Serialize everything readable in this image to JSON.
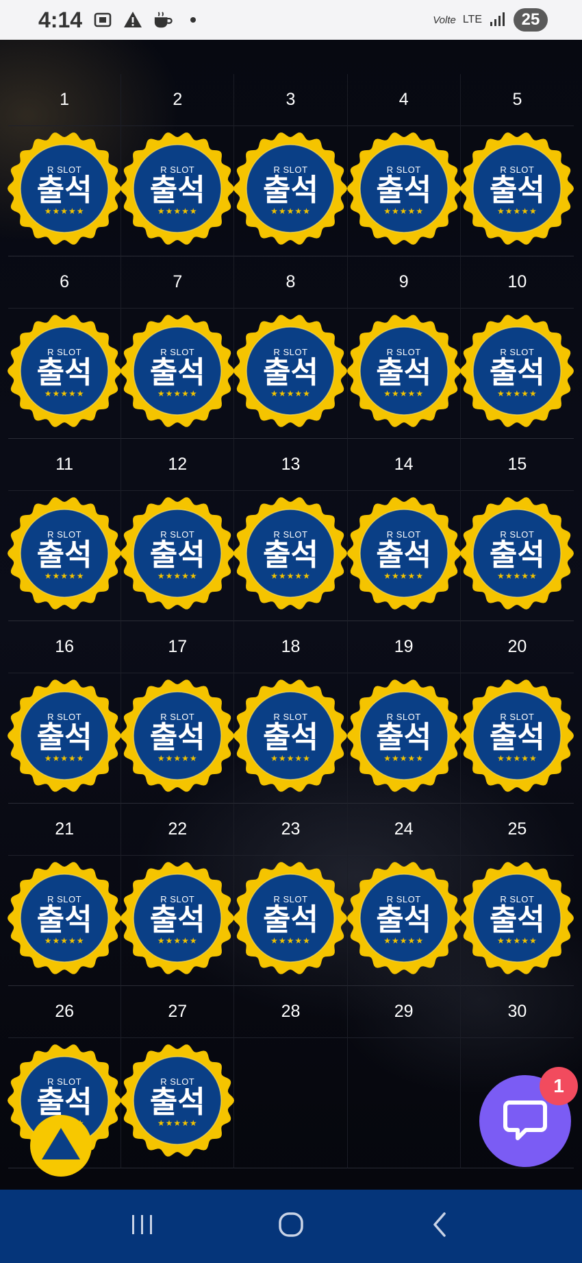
{
  "status_bar": {
    "time": "4:14",
    "network": "LTE",
    "volte": "Volte",
    "battery": "25",
    "icons": [
      "screenshot-icon",
      "warning-icon",
      "coffee-icon",
      "dot-icon",
      "signal-icon"
    ]
  },
  "calendar": {
    "stamp": {
      "brand": "R SLOT",
      "word": "출석",
      "stars": "★★★★★"
    },
    "days": [
      {
        "day": "1",
        "attended": true
      },
      {
        "day": "2",
        "attended": true
      },
      {
        "day": "3",
        "attended": true
      },
      {
        "day": "4",
        "attended": true
      },
      {
        "day": "5",
        "attended": true
      },
      {
        "day": "6",
        "attended": true
      },
      {
        "day": "7",
        "attended": true
      },
      {
        "day": "8",
        "attended": true
      },
      {
        "day": "9",
        "attended": true
      },
      {
        "day": "10",
        "attended": true
      },
      {
        "day": "11",
        "attended": true
      },
      {
        "day": "12",
        "attended": true
      },
      {
        "day": "13",
        "attended": true
      },
      {
        "day": "14",
        "attended": true
      },
      {
        "day": "15",
        "attended": true
      },
      {
        "day": "16",
        "attended": true
      },
      {
        "day": "17",
        "attended": true
      },
      {
        "day": "18",
        "attended": true
      },
      {
        "day": "19",
        "attended": true
      },
      {
        "day": "20",
        "attended": true
      },
      {
        "day": "21",
        "attended": true
      },
      {
        "day": "22",
        "attended": true
      },
      {
        "day": "23",
        "attended": true
      },
      {
        "day": "24",
        "attended": true
      },
      {
        "day": "25",
        "attended": true
      },
      {
        "day": "26",
        "attended": true
      },
      {
        "day": "27",
        "attended": true
      },
      {
        "day": "28",
        "attended": false
      },
      {
        "day": "29",
        "attended": false
      },
      {
        "day": "30",
        "attended": false
      }
    ]
  },
  "floating": {
    "chat_badge": "1",
    "scroll_top_icon": "triangle-up-icon",
    "chat_icon": "chat-bubble-icon"
  },
  "nav_bar": {
    "buttons": [
      "recent-apps-icon",
      "home-icon",
      "back-icon"
    ]
  },
  "colors": {
    "stamp_fill": "#0a3f86",
    "stamp_ring": "#f5c400",
    "nav_bg": "#05357a",
    "chat_bg": "#7b5cf4",
    "badge_bg": "#f24b5e",
    "scroll_top_bg": "#f7c800"
  }
}
